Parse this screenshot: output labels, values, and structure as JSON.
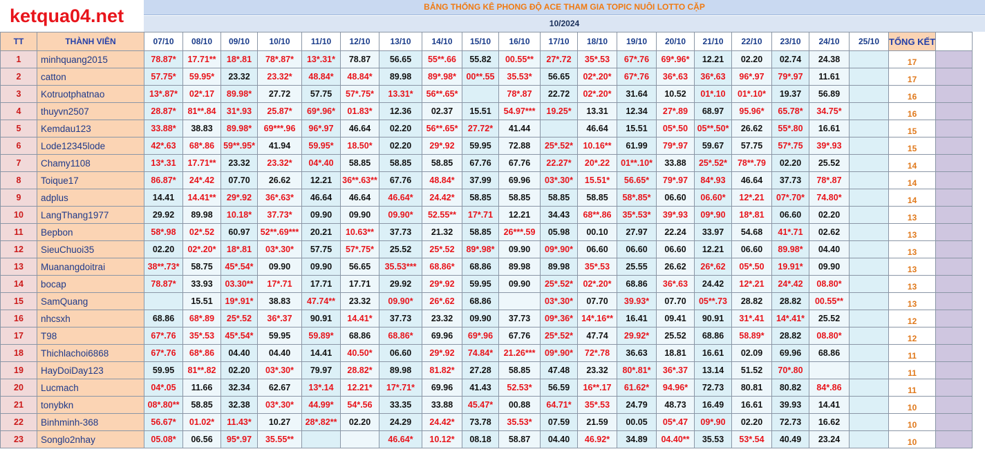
{
  "site_logo": "ketqua04.net",
  "title": "BẢNG THỐNG KÊ PHONG ĐỘ ACE THAM GIA TOPIC NUÔI LOTTO CẶP",
  "month": "10/2024",
  "headers": {
    "tt": "TT",
    "member": "THÀNH VIÊN",
    "dates": [
      "07/10",
      "08/10",
      "09/10",
      "10/10",
      "11/10",
      "12/10",
      "13/10",
      "14/10",
      "15/10",
      "16/10",
      "17/10",
      "18/10",
      "19/10",
      "20/10",
      "21/10",
      "22/10",
      "23/10",
      "24/10",
      "25/10"
    ],
    "total": "TỔNG KẾT"
  },
  "colors": {
    "hit": "#e8141b",
    "miss": "#111111",
    "name_bg": "#fbd4b4",
    "cell_bg": "#dcf0f7",
    "total_text": "#e0791c"
  },
  "rows": [
    {
      "tt": "1",
      "name": "minhquang2015",
      "cells": [
        "78.87*",
        "17.71**",
        "18*.81",
        "78*.87*",
        "13*.31*",
        "78.87",
        "56.65",
        "55**.66",
        "55.82",
        "00.55**",
        "27*.72",
        "35*.53",
        "67*.76",
        "69*.96*",
        "12.21",
        "02.20",
        "02.74",
        "24.38",
        ""
      ],
      "total": "17"
    },
    {
      "tt": "2",
      "name": "catton",
      "cells": [
        "57.75*",
        "59.95*",
        "23.32",
        "23.32*",
        "48.84*",
        "48.84*",
        "89.98",
        "89*.98*",
        "00**.55",
        "35.53*",
        "56.65",
        "02*.20*",
        "67*.76",
        "36*.63",
        "36*.63",
        "96*.97",
        "79*.97",
        "11.61",
        ""
      ],
      "total": "17"
    },
    {
      "tt": "3",
      "name": "Kotruotphatnao",
      "cells": [
        "13*.87*",
        "02*.17",
        "89.98*",
        "27.72",
        "57.75",
        "57*.75*",
        "13.31*",
        "56**.65*",
        "",
        "78*.87",
        "22.72",
        "02*.20*",
        "31.64",
        "10.52",
        "01*.10",
        "01*.10*",
        "19.37",
        "56.89",
        ""
      ],
      "total": "16"
    },
    {
      "tt": "4",
      "name": "thuyvn2507",
      "cells": [
        "28.87*",
        "81**.84",
        "31*.93",
        "25.87*",
        "69*.96*",
        "01.83*",
        "12.36",
        "02.37",
        "15.51",
        "54.97***",
        "19.25*",
        "13.31",
        "12.34",
        "27*.89",
        "68.97",
        "95.96*",
        "65.78*",
        "34.75*",
        ""
      ],
      "total": "16"
    },
    {
      "tt": "5",
      "name": "Kemdau123",
      "cells": [
        "33.88*",
        "38.83",
        "89.98*",
        "69***.96",
        "96*.97",
        "46.64",
        "02.20",
        "56**.65*",
        "27.72*",
        "41.44",
        "",
        "46.64",
        "15.51",
        "05*.50",
        "05**.50*",
        "26.62",
        "55*.80",
        "16.61",
        ""
      ],
      "total": "15"
    },
    {
      "tt": "6",
      "name": "Lode12345lode",
      "cells": [
        "42*.63",
        "68*.86",
        "59**.95*",
        "41.94",
        "59.95*",
        "18.50*",
        "02.20",
        "29*.92",
        "59.95",
        "72.88",
        "25*.52*",
        "10.16**",
        "61.99",
        "79*.97",
        "59.67",
        "57.75",
        "57*.75",
        "39*.93",
        ""
      ],
      "total": "15"
    },
    {
      "tt": "7",
      "name": "Chamy1108",
      "cells": [
        "13*.31",
        "17.71**",
        "23.32",
        "23.32*",
        "04*.40",
        "58.85",
        "58.85",
        "58.85",
        "67.76",
        "67.76",
        "22.27*",
        "20*.22",
        "01**.10*",
        "33.88",
        "25*.52*",
        "78**.79",
        "02.20",
        "25.52",
        ""
      ],
      "total": "14"
    },
    {
      "tt": "8",
      "name": "Toique17",
      "cells": [
        "86.87*",
        "24*.42",
        "07.70",
        "26.62",
        "12.21",
        "36**.63**",
        "67.76",
        "48.84*",
        "37.99",
        "69.96",
        "03*.30*",
        "15.51*",
        "56.65*",
        "79*.97",
        "84*.93",
        "46.64",
        "37.73",
        "78*.87",
        ""
      ],
      "total": "14"
    },
    {
      "tt": "9",
      "name": "adplus",
      "cells": [
        "14.41",
        "14.41**",
        "29*.92",
        "36*.63*",
        "46.64",
        "46.64",
        "46.64*",
        "24.42*",
        "58.85",
        "58.85",
        "58.85",
        "58.85",
        "58*.85*",
        "06.60",
        "06.60*",
        "12*.21",
        "07*.70*",
        "74.80*",
        ""
      ],
      "total": "14"
    },
    {
      "tt": "10",
      "name": "LangThang1977",
      "cells": [
        "29.92",
        "89.98",
        "10.18*",
        "37.73*",
        "09.90",
        "09.90",
        "09.90*",
        "52.55**",
        "17*.71",
        "12.21",
        "34.43",
        "68**.86",
        "35*.53*",
        "39*.93",
        "09*.90",
        "18*.81",
        "06.60",
        "02.20",
        ""
      ],
      "total": "13"
    },
    {
      "tt": "11",
      "name": "Bepbon",
      "cells": [
        "58*.98",
        "02*.52",
        "60.97",
        "52**.69***",
        "20.21",
        "10.63**",
        "37.73",
        "21.32",
        "58.85",
        "26***.59",
        "05.98",
        "00.10",
        "27.97",
        "22.24",
        "33.97",
        "54.68",
        "41*.71",
        "02.62",
        ""
      ],
      "total": "13"
    },
    {
      "tt": "12",
      "name": "SieuChuoi35",
      "cells": [
        "02.20",
        "02*.20*",
        "18*.81",
        "03*.30*",
        "57.75",
        "57*.75*",
        "25.52",
        "25*.52",
        "89*.98*",
        "09.90",
        "09*.90*",
        "06.60",
        "06.60",
        "06.60",
        "12.21",
        "06.60",
        "89.98*",
        "04.40",
        ""
      ],
      "total": "13"
    },
    {
      "tt": "13",
      "name": "Muanangdoitrai",
      "cells": [
        "38**.73*",
        "58.75",
        "45*.54*",
        "09.90",
        "09.90",
        "56.65",
        "35.53***",
        "68.86*",
        "68.86",
        "89.98",
        "89.98",
        "35*.53",
        "25.55",
        "26.62",
        "26*.62",
        "05*.50",
        "19.91*",
        "09.90",
        ""
      ],
      "total": "13"
    },
    {
      "tt": "14",
      "name": "bocap",
      "cells": [
        "78.87*",
        "33.93",
        "03.30**",
        "17*.71",
        "17.71",
        "17.71",
        "29.92",
        "29*.92",
        "59.95",
        "09.90",
        "25*.52*",
        "02*.20*",
        "68.86",
        "36*.63",
        "24.42",
        "12*.21",
        "24*.42",
        "08.80*",
        ""
      ],
      "total": "13"
    },
    {
      "tt": "15",
      "name": "SamQuang",
      "cells": [
        "",
        "15.51",
        "19*.91*",
        "38.83",
        "47.74**",
        "23.32",
        "09.90*",
        "26*.62",
        "68.86",
        "",
        "03*.30*",
        "07.70",
        "39.93*",
        "07.70",
        "05**.73",
        "28.82",
        "28.82",
        "00.55**",
        ""
      ],
      "total": "13"
    },
    {
      "tt": "16",
      "name": "nhcsxh",
      "cells": [
        "68.86",
        "68*.89",
        "25*.52",
        "36*.37",
        "90.91",
        "14.41*",
        "37.73",
        "23.32",
        "09.90",
        "37.73",
        "09*.36*",
        "14*.16**",
        "16.41",
        "09.41",
        "90.91",
        "31*.41",
        "14*.41*",
        "25.52",
        ""
      ],
      "total": "12"
    },
    {
      "tt": "17",
      "name": "T98",
      "cells": [
        "67*.76",
        "35*.53",
        "45*.54*",
        "59.95",
        "59.89*",
        "68.86",
        "68.86*",
        "69.96",
        "69*.96",
        "67.76",
        "25*.52*",
        "47.74",
        "29.92*",
        "25.52",
        "68.86",
        "58.89*",
        "28.82",
        "08.80*",
        ""
      ],
      "total": "12"
    },
    {
      "tt": "18",
      "name": "Thichlachoi6868",
      "cells": [
        "67*.76",
        "68*.86",
        "04.40",
        "04.40",
        "14.41",
        "40.50*",
        "06.60",
        "29*.92",
        "74.84*",
        "21.26***",
        "09*.90*",
        "72*.78",
        "36.63",
        "18.81",
        "16.61",
        "02.09",
        "69.96",
        "68.86",
        ""
      ],
      "total": "11"
    },
    {
      "tt": "19",
      "name": "HayDoiDay123",
      "cells": [
        "59.95",
        "81**.82",
        "02.20",
        "03*.30*",
        "79.97",
        "28.82*",
        "89.98",
        "81.82*",
        "27.28",
        "58.85",
        "47.48",
        "23.32",
        "80*.81*",
        "36*.37",
        "13.14",
        "51.52",
        "70*.80",
        "",
        ""
      ],
      "total": "11"
    },
    {
      "tt": "20",
      "name": "Lucmach",
      "cells": [
        "04*.05",
        "11.66",
        "32.34",
        "62.67",
        "13*.14",
        "12.21*",
        "17*.71*",
        "69.96",
        "41.43",
        "52.53*",
        "56.59",
        "16**.17",
        "61.62*",
        "94.96*",
        "72.73",
        "80.81",
        "80.82",
        "84*.86",
        ""
      ],
      "total": "11"
    },
    {
      "tt": "21",
      "name": "tonybkn",
      "cells": [
        "08*.80**",
        "58.85",
        "32.38",
        "03*.30*",
        "44.99*",
        "54*.56",
        "33.35",
        "33.88",
        "45.47*",
        "00.88",
        "64.71*",
        "35*.53",
        "24.79",
        "48.73",
        "16.49",
        "16.61",
        "39.93",
        "14.41",
        ""
      ],
      "total": "10"
    },
    {
      "tt": "22",
      "name": "Binhminh-368",
      "cells": [
        "56.67*",
        "01.02*",
        "11.43*",
        "10.27",
        "28*.82**",
        "02.20",
        "24.29",
        "24.42*",
        "73.78",
        "35.53*",
        "07.59",
        "21.59",
        "00.05",
        "05*.47",
        "09*.90",
        "02.20",
        "72.73",
        "16.62",
        ""
      ],
      "total": "10"
    },
    {
      "tt": "23",
      "name": "Songlo2nhay",
      "cells": [
        "05.08*",
        "06.56",
        "95*.97",
        "35.55**",
        "",
        "",
        "46.64*",
        "10.12*",
        "08.18",
        "58.87",
        "04.40",
        "46.92*",
        "34.89",
        "04.40**",
        "35.53",
        "53*.54",
        "40.49",
        "23.24",
        ""
      ],
      "total": "10"
    }
  ]
}
